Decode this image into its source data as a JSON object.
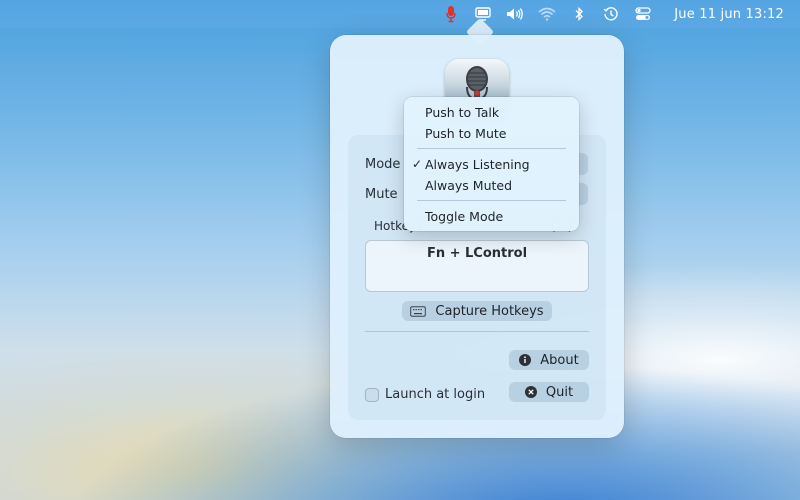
{
  "menubar": {
    "icons": [
      "microphone-icon",
      "display-icon",
      "volume-icon",
      "wifi-icon",
      "bluetooth-icon",
      "time-machine-icon",
      "control-center-icon"
    ],
    "clock": "Jue 11 jun 13:12",
    "accent_mic": "#e0332b"
  },
  "popover": {
    "mode_label": "Mode",
    "mute_label": "Mute",
    "hotkeys_caption": "Hotkeys",
    "hotkeys_caption_tail": "(…)",
    "hotkey_value": "Fn + LControl",
    "capture_button": "Capture Hotkeys",
    "about_button": "About",
    "quit_button": "Quit",
    "launch_at_login": "Launch at login"
  },
  "dropdown": {
    "items": [
      {
        "label": "Push to Talk",
        "checked": false
      },
      {
        "label": "Push to Mute",
        "checked": false
      },
      {
        "label": "Always Listening",
        "checked": true
      },
      {
        "label": "Always Muted",
        "checked": false
      },
      {
        "label": "Toggle Mode",
        "checked": false
      }
    ],
    "checkmark": "✓"
  }
}
